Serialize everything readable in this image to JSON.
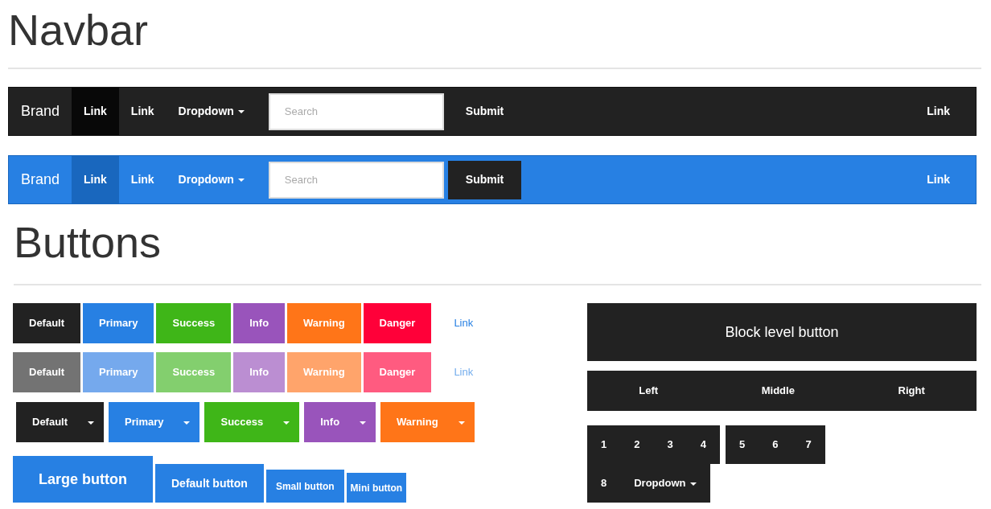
{
  "navbar_section": {
    "heading": "Navbar",
    "navbars": [
      {
        "brand": "Brand",
        "items": [
          {
            "label": "Link",
            "kind": "link",
            "selected": true
          },
          {
            "label": "Link",
            "kind": "link",
            "selected": false
          },
          {
            "label": "Dropdown",
            "kind": "dropdown",
            "selected": false
          }
        ],
        "search": {
          "placeholder": "Search"
        },
        "submit": "Submit",
        "right_link": "Link"
      },
      {
        "brand": "Brand",
        "items": [
          {
            "label": "Link",
            "kind": "link",
            "selected": true
          },
          {
            "label": "Link",
            "kind": "link",
            "selected": false
          },
          {
            "label": "Dropdown",
            "kind": "dropdown",
            "selected": false
          }
        ],
        "search": {
          "placeholder": "Search"
        },
        "submit": "Submit",
        "right_link": "Link"
      }
    ]
  },
  "buttons_section": {
    "heading": "Buttons",
    "rows": [
      {
        "kind": "plain",
        "disabled": false,
        "buttons": [
          {
            "label": "Default",
            "kind": "button",
            "color": "#222222"
          },
          {
            "label": "Primary",
            "kind": "button",
            "color": "#2780e3"
          },
          {
            "label": "Success",
            "kind": "button",
            "color": "#3fb618"
          },
          {
            "label": "Info",
            "kind": "button",
            "color": "#9954bb"
          },
          {
            "label": "Warning",
            "kind": "button",
            "color": "#ff7518"
          },
          {
            "label": "Danger",
            "kind": "button",
            "color": "#ff0039"
          },
          {
            "label": "Link",
            "kind": "link"
          }
        ]
      },
      {
        "kind": "plain",
        "disabled": true,
        "buttons": [
          {
            "label": "Default",
            "kind": "button",
            "color": "#737373"
          },
          {
            "label": "Primary",
            "kind": "button",
            "color": "#75a9ed"
          },
          {
            "label": "Success",
            "kind": "button",
            "color": "#83cf6e"
          },
          {
            "label": "Info",
            "kind": "button",
            "color": "#bb8ed2"
          },
          {
            "label": "Warning",
            "kind": "button",
            "color": "#ffa46b"
          },
          {
            "label": "Danger",
            "kind": "button",
            "color": "#ff5b80"
          },
          {
            "label": "Link",
            "kind": "link"
          }
        ]
      },
      {
        "kind": "split",
        "buttons": [
          {
            "label": "Default",
            "color": "#222222"
          },
          {
            "label": "Primary",
            "color": "#2780e3"
          },
          {
            "label": "Success",
            "color": "#3fb618"
          },
          {
            "label": "Info",
            "color": "#9954bb"
          },
          {
            "label": "Warning",
            "color": "#ff7518"
          }
        ]
      },
      {
        "kind": "sizes",
        "buttons": [
          {
            "label": "Large button"
          },
          {
            "label": "Default button"
          },
          {
            "label": "Small button"
          },
          {
            "label": "Mini button"
          }
        ]
      }
    ],
    "block_button": "Block level button",
    "justified_group": [
      "Left",
      "Middle",
      "Right"
    ],
    "toolbar_groups": [
      [
        {
          "label": "1",
          "kind": "plain"
        },
        {
          "label": "2",
          "kind": "plain"
        },
        {
          "label": "3",
          "kind": "plain"
        },
        {
          "label": "4",
          "kind": "plain"
        }
      ],
      [
        {
          "label": "5",
          "kind": "plain"
        },
        {
          "label": "6",
          "kind": "plain"
        },
        {
          "label": "7",
          "kind": "plain"
        }
      ],
      [
        {
          "label": "8",
          "kind": "plain"
        },
        {
          "label": "Dropdown",
          "kind": "dropdown"
        }
      ]
    ]
  }
}
